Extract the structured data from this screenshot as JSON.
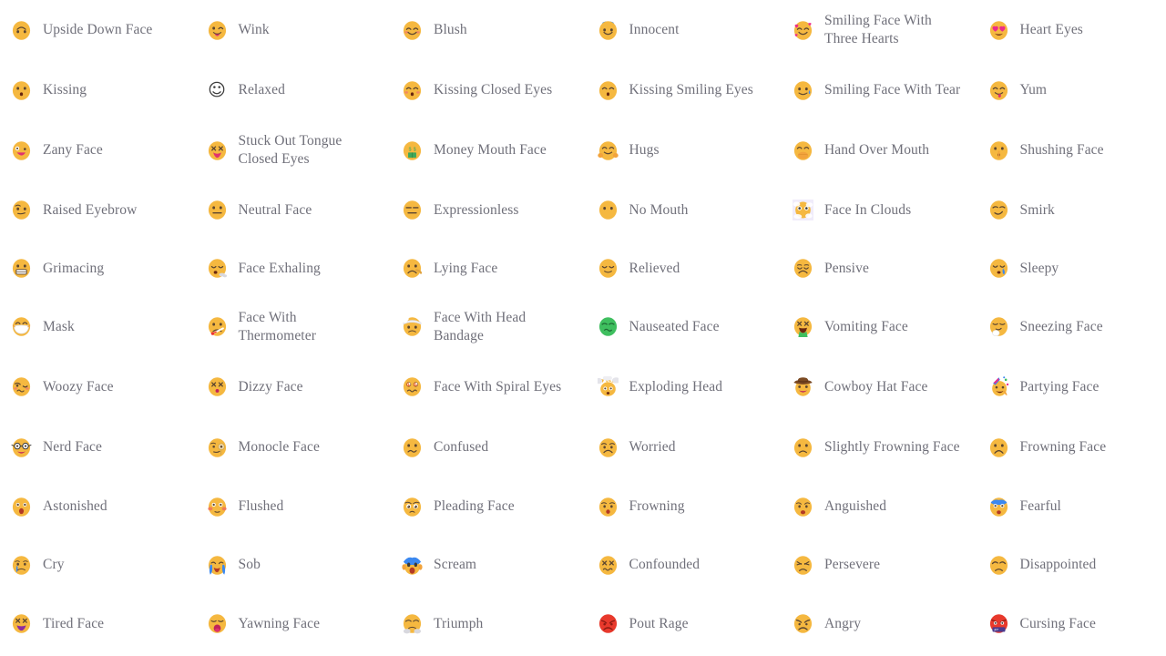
{
  "page": {
    "title": "Emoji List",
    "background_color": "#ffffff",
    "label_color": "#70707a",
    "columns": 6,
    "rows": 11,
    "total_items": 66
  },
  "emojis": [
    {
      "label": "Upside Down Face",
      "icon": "upside-down-face-icon",
      "char": "🙃",
      "face_color": "#f5b840",
      "style": "color"
    },
    {
      "label": "Wink",
      "icon": "wink-icon",
      "char": "😜",
      "face_color": "#f5b840",
      "style": "color"
    },
    {
      "label": "Blush",
      "icon": "blush-icon",
      "char": "☺️",
      "face_color": "#f5b840",
      "style": "color"
    },
    {
      "label": "Innocent",
      "icon": "innocent-icon",
      "char": "😇",
      "face_color": "#f5b840",
      "style": "color"
    },
    {
      "label": "Smiling Face With Three Hearts",
      "icon": "smiling-face-with-three-hearts-icon",
      "char": "🥰",
      "face_color": "#f5b840",
      "style": "color"
    },
    {
      "label": "Heart Eyes",
      "icon": "heart-eyes-icon",
      "char": "😍",
      "face_color": "#f5b840",
      "style": "color"
    },
    {
      "label": "Kissing",
      "icon": "kissing-icon",
      "char": "😗",
      "face_color": "#f5b840",
      "style": "color"
    },
    {
      "label": "Relaxed",
      "icon": "relaxed-icon",
      "char": "☺",
      "face_color": "#3b3b3b",
      "style": "mono"
    },
    {
      "label": "Kissing Closed Eyes",
      "icon": "kissing-closed-eyes-icon",
      "char": "😚",
      "face_color": "#f5b840",
      "style": "color"
    },
    {
      "label": "Kissing Smiling Eyes",
      "icon": "kissing-smiling-eyes-icon",
      "char": "😙",
      "face_color": "#f5b840",
      "style": "color"
    },
    {
      "label": "Smiling Face With Tear",
      "icon": "smiling-face-with-tear-icon",
      "char": "🥲",
      "face_color": "#f5b840",
      "style": "color"
    },
    {
      "label": "Yum",
      "icon": "yum-icon",
      "char": "😋",
      "face_color": "#f5b840",
      "style": "color"
    },
    {
      "label": "Zany Face",
      "icon": "zany-face-icon",
      "char": "🤪",
      "face_color": "#f5b840",
      "style": "color"
    },
    {
      "label": "Stuck Out Tongue Closed Eyes",
      "icon": "stuck-out-tongue-closed-eyes-icon",
      "char": "😝",
      "face_color": "#f5b840",
      "style": "color"
    },
    {
      "label": "Money Mouth Face",
      "icon": "money-mouth-face-icon",
      "char": "🤑",
      "face_color": "#f5b840",
      "style": "color"
    },
    {
      "label": "Hugs",
      "icon": "hugs-icon",
      "char": "🤗",
      "face_color": "#f5b840",
      "style": "color"
    },
    {
      "label": "Hand Over Mouth",
      "icon": "hand-over-mouth-icon",
      "char": "🤭",
      "face_color": "#f5b840",
      "style": "color"
    },
    {
      "label": "Shushing Face",
      "icon": "shushing-face-icon",
      "char": "🤫",
      "face_color": "#f5b840",
      "style": "color"
    },
    {
      "label": "Raised Eyebrow",
      "icon": "raised-eyebrow-icon",
      "char": "🤨",
      "face_color": "#f5b840",
      "style": "color"
    },
    {
      "label": "Neutral Face",
      "icon": "neutral-face-icon",
      "char": "😐",
      "face_color": "#f5b840",
      "style": "color"
    },
    {
      "label": "Expressionless",
      "icon": "expressionless-icon",
      "char": "😑",
      "face_color": "#f5b840",
      "style": "color"
    },
    {
      "label": "No Mouth",
      "icon": "no-mouth-icon",
      "char": "😶",
      "face_color": "#f5b840",
      "style": "color"
    },
    {
      "label": "Face In Clouds",
      "icon": "face-in-clouds-icon",
      "char": "😶‍🌫️",
      "face_color": "#f5b840",
      "style": "clouds"
    },
    {
      "label": "Smirk",
      "icon": "smirk-icon",
      "char": "😏",
      "face_color": "#f5b840",
      "style": "color"
    },
    {
      "label": "Grimacing",
      "icon": "grimacing-icon",
      "char": "😬",
      "face_color": "#f5b840",
      "style": "color"
    },
    {
      "label": "Face Exhaling",
      "icon": "face-exhaling-icon",
      "char": "😮‍💨",
      "face_color": "#f5b840",
      "style": "color"
    },
    {
      "label": "Lying Face",
      "icon": "lying-face-icon",
      "char": "🤥",
      "face_color": "#f5b840",
      "style": "color"
    },
    {
      "label": "Relieved",
      "icon": "relieved-icon",
      "char": "😌",
      "face_color": "#f5b840",
      "style": "color"
    },
    {
      "label": "Pensive",
      "icon": "pensive-icon",
      "char": "😔",
      "face_color": "#f5b840",
      "style": "color"
    },
    {
      "label": "Sleepy",
      "icon": "sleepy-icon",
      "char": "😪",
      "face_color": "#f5b840",
      "style": "color"
    },
    {
      "label": "Mask",
      "icon": "mask-icon",
      "char": "😷",
      "face_color": "#f5b840",
      "style": "color"
    },
    {
      "label": "Face With Thermometer",
      "icon": "face-with-thermometer-icon",
      "char": "🤒",
      "face_color": "#f5b840",
      "style": "color"
    },
    {
      "label": "Face With Head Bandage",
      "icon": "face-with-head-bandage-icon",
      "char": "🤕",
      "face_color": "#f5b840",
      "style": "color"
    },
    {
      "label": "Nauseated Face",
      "icon": "nauseated-face-icon",
      "char": "🤢",
      "face_color": "#3fbf5f",
      "style": "color"
    },
    {
      "label": "Vomiting Face",
      "icon": "vomiting-face-icon",
      "char": "🤮",
      "face_color": "#f5b840",
      "style": "color"
    },
    {
      "label": "Sneezing Face",
      "icon": "sneezing-face-icon",
      "char": "🤧",
      "face_color": "#f5b840",
      "style": "color"
    },
    {
      "label": "Woozy Face",
      "icon": "woozy-face-icon",
      "char": "🥴",
      "face_color": "#f5b840",
      "style": "color"
    },
    {
      "label": "Dizzy Face",
      "icon": "dizzy-face-icon",
      "char": "😵",
      "face_color": "#f5b840",
      "style": "color"
    },
    {
      "label": "Face With Spiral Eyes",
      "icon": "face-with-spiral-eyes-icon",
      "char": "😵‍💫",
      "face_color": "#f5b840",
      "style": "color"
    },
    {
      "label": "Exploding Head",
      "icon": "exploding-head-icon",
      "char": "🤯",
      "face_color": "#f5b840",
      "style": "color"
    },
    {
      "label": "Cowboy Hat Face",
      "icon": "cowboy-hat-face-icon",
      "char": "🤠",
      "face_color": "#f5b840",
      "style": "color"
    },
    {
      "label": "Partying Face",
      "icon": "partying-face-icon",
      "char": "🥳",
      "face_color": "#f5b840",
      "style": "color"
    },
    {
      "label": "Nerd Face",
      "icon": "nerd-face-icon",
      "char": "🤓",
      "face_color": "#f5b840",
      "style": "color"
    },
    {
      "label": "Monocle Face",
      "icon": "monocle-face-icon",
      "char": "🧐",
      "face_color": "#f5b840",
      "style": "color"
    },
    {
      "label": "Confused",
      "icon": "confused-icon",
      "char": "😕",
      "face_color": "#f5b840",
      "style": "color"
    },
    {
      "label": "Worried",
      "icon": "worried-icon",
      "char": "😟",
      "face_color": "#f5b840",
      "style": "color"
    },
    {
      "label": "Slightly Frowning Face",
      "icon": "slightly-frowning-face-icon",
      "char": "🙁",
      "face_color": "#f5b840",
      "style": "color"
    },
    {
      "label": "Frowning Face",
      "icon": "frowning-face-icon",
      "char": "☹️",
      "face_color": "#f5b840",
      "style": "color"
    },
    {
      "label": "Astonished",
      "icon": "astonished-icon",
      "char": "😲",
      "face_color": "#f5b840",
      "style": "color"
    },
    {
      "label": "Flushed",
      "icon": "flushed-icon",
      "char": "😳",
      "face_color": "#f5b840",
      "style": "color"
    },
    {
      "label": "Pleading Face",
      "icon": "pleading-face-icon",
      "char": "🥺",
      "face_color": "#f5b840",
      "style": "color"
    },
    {
      "label": "Frowning",
      "icon": "frowning-icon",
      "char": "😦",
      "face_color": "#f5b840",
      "style": "color"
    },
    {
      "label": "Anguished",
      "icon": "anguished-icon",
      "char": "😧",
      "face_color": "#f5b840",
      "style": "color"
    },
    {
      "label": "Fearful",
      "icon": "fearful-icon",
      "char": "😨",
      "face_color": "#f5b840",
      "style": "color"
    },
    {
      "label": "Cry",
      "icon": "cry-icon",
      "char": "😢",
      "face_color": "#f5b840",
      "style": "color"
    },
    {
      "label": "Sob",
      "icon": "sob-icon",
      "char": "😭",
      "face_color": "#f5b840",
      "style": "color"
    },
    {
      "label": "Scream",
      "icon": "scream-icon",
      "char": "😱",
      "face_color": "#f5b840",
      "style": "color"
    },
    {
      "label": "Confounded",
      "icon": "confounded-icon",
      "char": "😖",
      "face_color": "#f5b840",
      "style": "color"
    },
    {
      "label": "Persevere",
      "icon": "persevere-icon",
      "char": "😣",
      "face_color": "#f5b840",
      "style": "color"
    },
    {
      "label": "Disappointed",
      "icon": "disappointed-icon",
      "char": "😞",
      "face_color": "#f5b840",
      "style": "color"
    },
    {
      "label": "Tired Face",
      "icon": "tired-face-icon",
      "char": "😫",
      "face_color": "#f5b840",
      "style": "color"
    },
    {
      "label": "Yawning Face",
      "icon": "yawning-face-icon",
      "char": "🥱",
      "face_color": "#f5b840",
      "style": "color"
    },
    {
      "label": "Triumph",
      "icon": "triumph-icon",
      "char": "😤",
      "face_color": "#f5b840",
      "style": "color"
    },
    {
      "label": "Pout Rage",
      "icon": "pout-rage-icon",
      "char": "😡",
      "face_color": "#e8392c",
      "style": "color"
    },
    {
      "label": "Angry",
      "icon": "angry-icon",
      "char": "😠",
      "face_color": "#f5b840",
      "style": "color"
    },
    {
      "label": "Cursing Face",
      "icon": "cursing-face-icon",
      "char": "🤬",
      "face_color": "#e8392c",
      "style": "color"
    }
  ]
}
